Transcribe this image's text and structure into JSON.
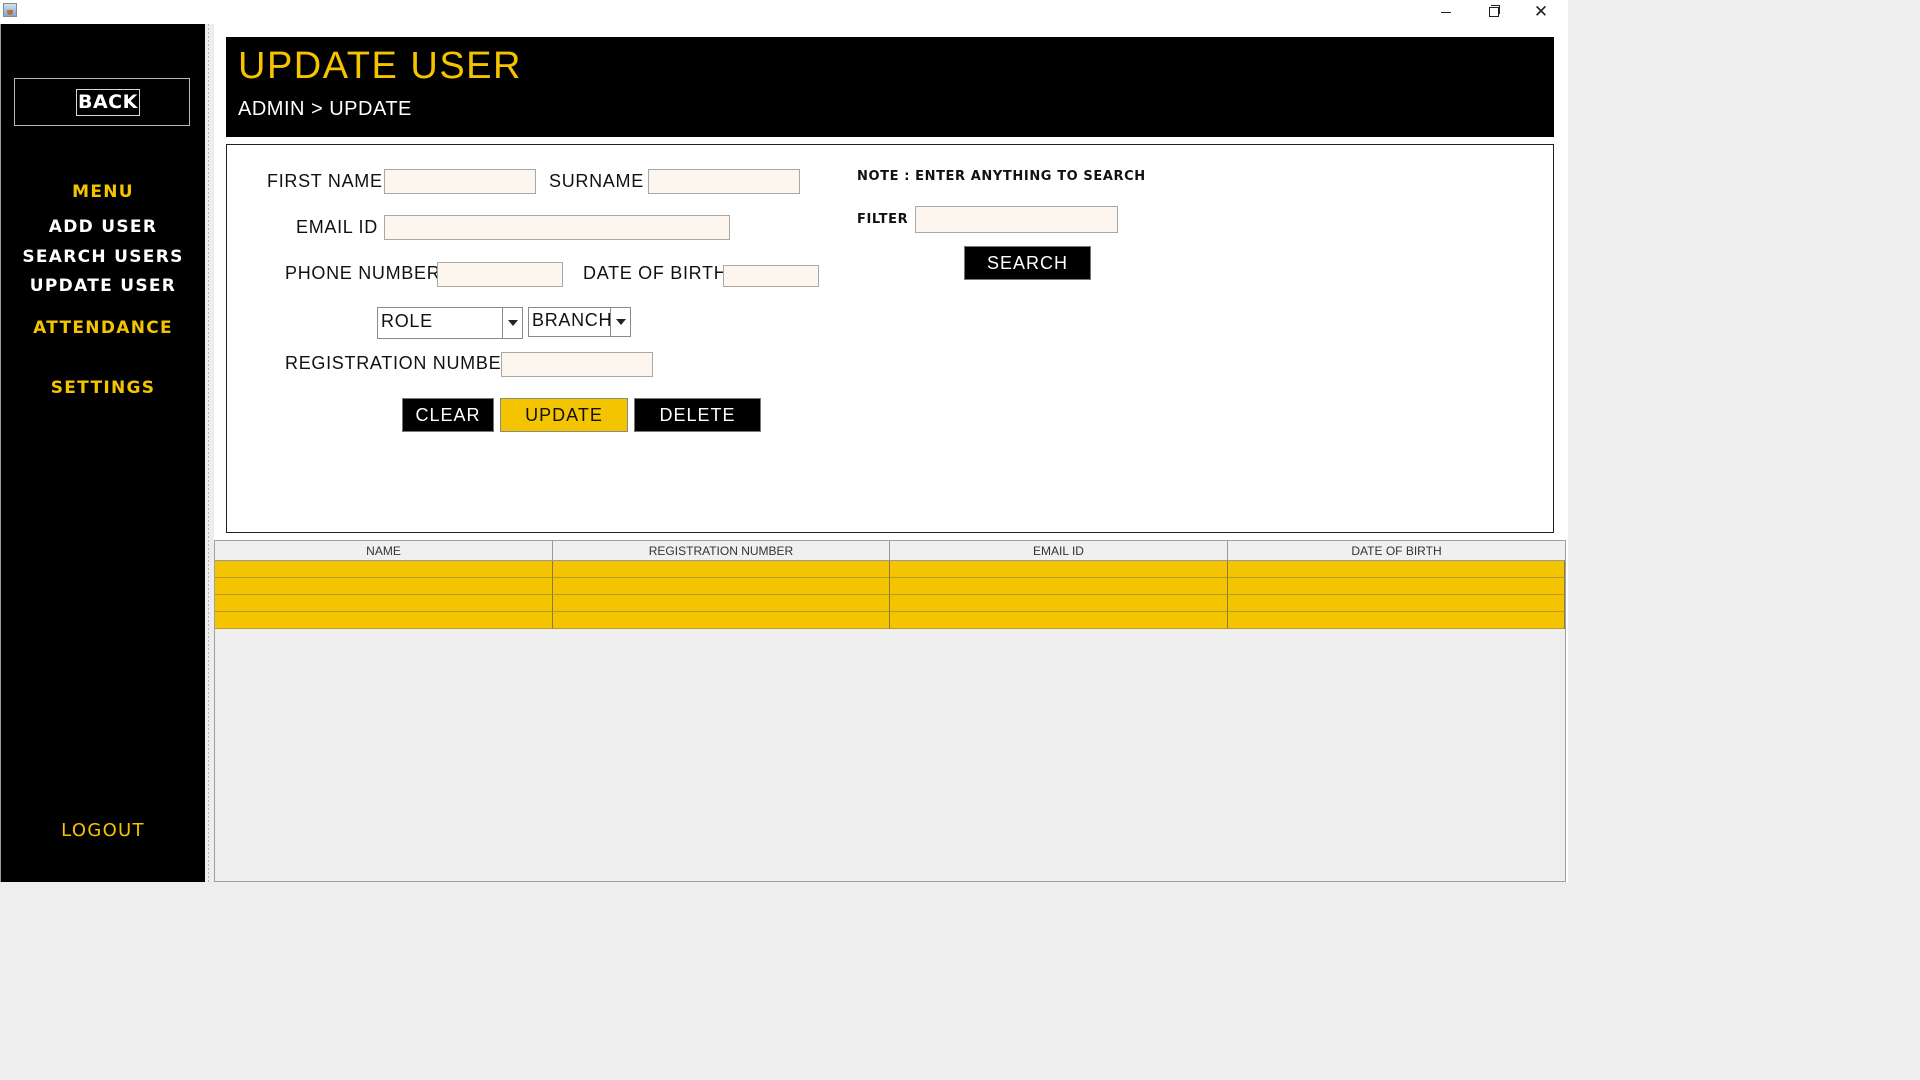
{
  "window": {
    "minimize_icon": "minimize-icon",
    "maximize_icon": "restore-icon",
    "close_glyph": "✕"
  },
  "sidebar": {
    "back_label": "BACK",
    "menu_heading": "MENU",
    "items": [
      {
        "label": "ADD USER"
      },
      {
        "label": "SEARCH USERS"
      },
      {
        "label": "UPDATE USER"
      }
    ],
    "attendance_label": "ATTENDANCE",
    "settings_label": "SETTINGS",
    "logout_label": "LOGOUT"
  },
  "header": {
    "title": "UPDATE USER",
    "breadcrumb": "ADMIN > UPDATE"
  },
  "form": {
    "first_name_label": "FIRST NAME",
    "first_name_value": "",
    "surname_label": "SURNAME",
    "surname_value": "",
    "email_label": "EMAIL ID",
    "email_value": "",
    "phone_label": "PHONE NUMBER",
    "phone_value": "",
    "dob_label": "DATE OF BIRTH",
    "dob_value": "",
    "role_selected": "ROLE",
    "branch_selected": "BRANCH",
    "registration_label": "REGISTRATION NUMBER",
    "registration_value": "",
    "clear_label": "CLEAR",
    "update_label": "UPDATE",
    "delete_label": "DELETE"
  },
  "search": {
    "note": "NOTE : ENTER ANYTHING TO SEARCH",
    "filter_label": "FILTER",
    "filter_value": "",
    "search_label": "SEARCH"
  },
  "table": {
    "columns": [
      "NAME",
      "REGISTRATION NUMBER",
      "EMAIL ID",
      "DATE OF BIRTH"
    ],
    "rows": [
      [
        "",
        "",
        "",
        ""
      ],
      [
        "",
        "",
        "",
        ""
      ],
      [
        "",
        "",
        "",
        ""
      ],
      [
        "",
        "",
        "",
        ""
      ]
    ]
  },
  "colors": {
    "accent": "#f5c400",
    "sidebar_bg": "#000000",
    "header_bg": "#000000",
    "field_bg": "#fdf6ee"
  }
}
